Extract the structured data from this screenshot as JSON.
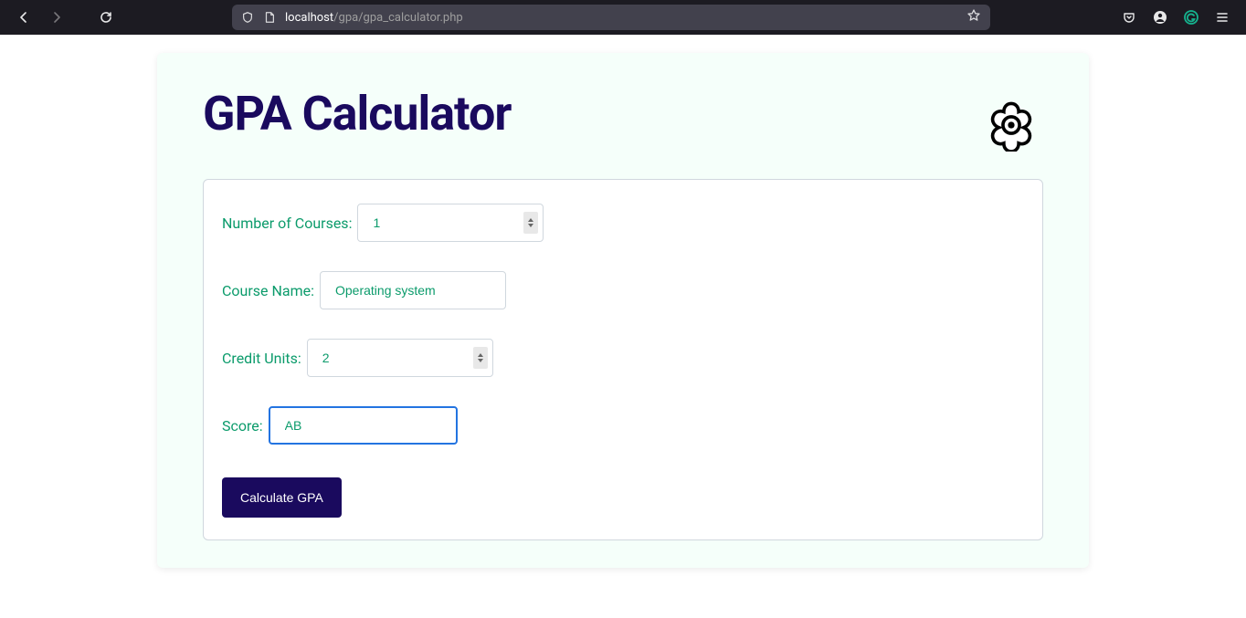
{
  "browser": {
    "url_host": "localhost",
    "url_path": "/gpa/gpa_calculator.php"
  },
  "page": {
    "title": "GPA Calculator",
    "form": {
      "num_courses_label": "Number of Courses:",
      "num_courses_value": "1",
      "course_name_label": "Course Name:",
      "course_name_value": "Operating system",
      "credit_units_label": "Credit Units:",
      "credit_units_value": "2",
      "score_label": "Score:",
      "score_value": "AB",
      "submit_label": "Calculate GPA"
    }
  }
}
